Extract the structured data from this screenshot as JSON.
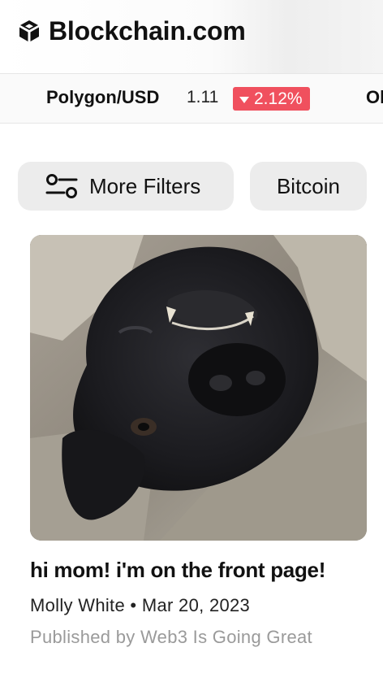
{
  "header": {
    "brand": "Blockchain.com",
    "logo_icon": "blockchain-cube-icon"
  },
  "ticker": {
    "pair": "Polygon/USD",
    "price": "1.11",
    "change": "2.12%",
    "change_direction": "down",
    "change_color": "#f0505e",
    "next_pair_partial": "Ol"
  },
  "filters": {
    "more_filters_label": "More Filters",
    "more_filters_icon": "sliders-icon",
    "category_label": "Bitcoin"
  },
  "article": {
    "image_alt": "Black dog lying upside down on a floral blanket",
    "title": "hi mom! i'm on the front page!",
    "author": "Molly White",
    "separator": "•",
    "date": "Mar 20, 2023",
    "published_by": "Published by Web3 Is Going Great"
  }
}
